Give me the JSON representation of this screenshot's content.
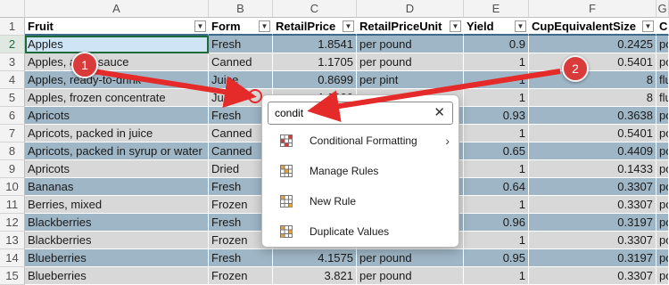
{
  "columns": [
    "A",
    "B",
    "C",
    "D",
    "E",
    "F",
    "G"
  ],
  "header_row": {
    "num": "1",
    "cells": [
      "Fruit",
      "Form",
      "RetailPrice",
      "RetailPriceUnit",
      "Yield",
      "CupEquivalentSize",
      "C"
    ]
  },
  "rows": [
    {
      "num": "2",
      "cells": [
        "Apples",
        "Fresh",
        "1.8541",
        "per pound",
        "0.9",
        "0.2425",
        "po"
      ]
    },
    {
      "num": "3",
      "cells": [
        "Apples, applesauce",
        "Canned",
        "1.1705",
        "per pound",
        "1",
        "0.5401",
        "po"
      ]
    },
    {
      "num": "4",
      "cells": [
        "Apples, ready-to-drink",
        "Juice",
        "0.8699",
        "per pint",
        "1",
        "8",
        "flu"
      ]
    },
    {
      "num": "5",
      "cells": [
        "Apples, frozen concentrate",
        "Juice",
        "1.0000",
        "",
        "1",
        "8",
        "flu"
      ]
    },
    {
      "num": "6",
      "cells": [
        "Apricots",
        "Fresh",
        "",
        "",
        "0.93",
        "0.3638",
        "po"
      ]
    },
    {
      "num": "7",
      "cells": [
        "Apricots, packed in juice",
        "Canned",
        "",
        "",
        "1",
        "0.5401",
        "po"
      ]
    },
    {
      "num": "8",
      "cells": [
        "Apricots, packed in syrup or water",
        "Canned",
        "",
        "",
        "0.65",
        "0.4409",
        "po"
      ]
    },
    {
      "num": "9",
      "cells": [
        "Apricots",
        "Dried",
        "",
        "",
        "1",
        "0.1433",
        "po"
      ]
    },
    {
      "num": "10",
      "cells": [
        "Bananas",
        "Fresh",
        "",
        "",
        "0.64",
        "0.3307",
        "po"
      ]
    },
    {
      "num": "11",
      "cells": [
        "Berries, mixed",
        "Frozen",
        "",
        "",
        "1",
        "0.3307",
        "po"
      ]
    },
    {
      "num": "12",
      "cells": [
        "Blackberries",
        "Fresh",
        "",
        "",
        "0.96",
        "0.3197",
        "po"
      ]
    },
    {
      "num": "13",
      "cells": [
        "Blackberries",
        "Frozen",
        "",
        "",
        "1",
        "0.3307",
        "po"
      ]
    },
    {
      "num": "14",
      "cells": [
        "Blueberries",
        "Fresh",
        "4.1575",
        "per pound",
        "0.95",
        "0.3197",
        "po"
      ]
    },
    {
      "num": "15",
      "cells": [
        "Blueberries",
        "Frozen",
        "3.821",
        "per pound",
        "1",
        "0.3307",
        "po"
      ]
    }
  ],
  "search": {
    "value": "condit",
    "clear_icon": "close-icon"
  },
  "menu_items": [
    {
      "label": "Conditional Formatting",
      "icon": "conditional-formatting-icon",
      "submenu": true
    },
    {
      "label": "Manage Rules",
      "icon": "manage-rules-icon",
      "submenu": false
    },
    {
      "label": "New Rule",
      "icon": "new-rule-icon",
      "submenu": false
    },
    {
      "label": "Duplicate Values",
      "icon": "duplicate-values-icon",
      "submenu": false
    }
  ],
  "callouts": [
    "1",
    "2"
  ],
  "colors": {
    "accent": "#1e6b3a",
    "callout": "#d93a3a",
    "row_dark": "#9fb6c6",
    "row_light": "#d8d8d8"
  }
}
